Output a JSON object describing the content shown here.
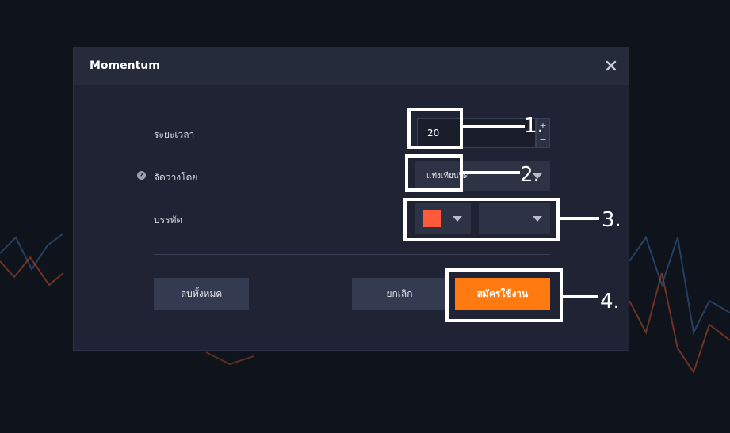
{
  "dialog": {
    "title": "Momentum"
  },
  "form": {
    "period": {
      "label": "ระยะเวลา",
      "value": "20",
      "increment_symbol": "+",
      "decrement_symbol": "−"
    },
    "source": {
      "label": "จัดวางโดย",
      "help_symbol": "?",
      "selected": "แท่งเทียนปิด"
    },
    "line": {
      "label": "บรรทัด",
      "color": "#ff5a3c",
      "style_value": "—"
    }
  },
  "buttons": {
    "clear_all": "ลบทั้งหมด",
    "cancel": "ยกเลิก",
    "apply": "สมัครใช้งาน"
  },
  "annotations": [
    "1.",
    "2.",
    "3.",
    "4."
  ],
  "colors": {
    "accent": "#ff7a10",
    "dialog_bg": "#1f2333",
    "header_bg": "#262b3c"
  }
}
